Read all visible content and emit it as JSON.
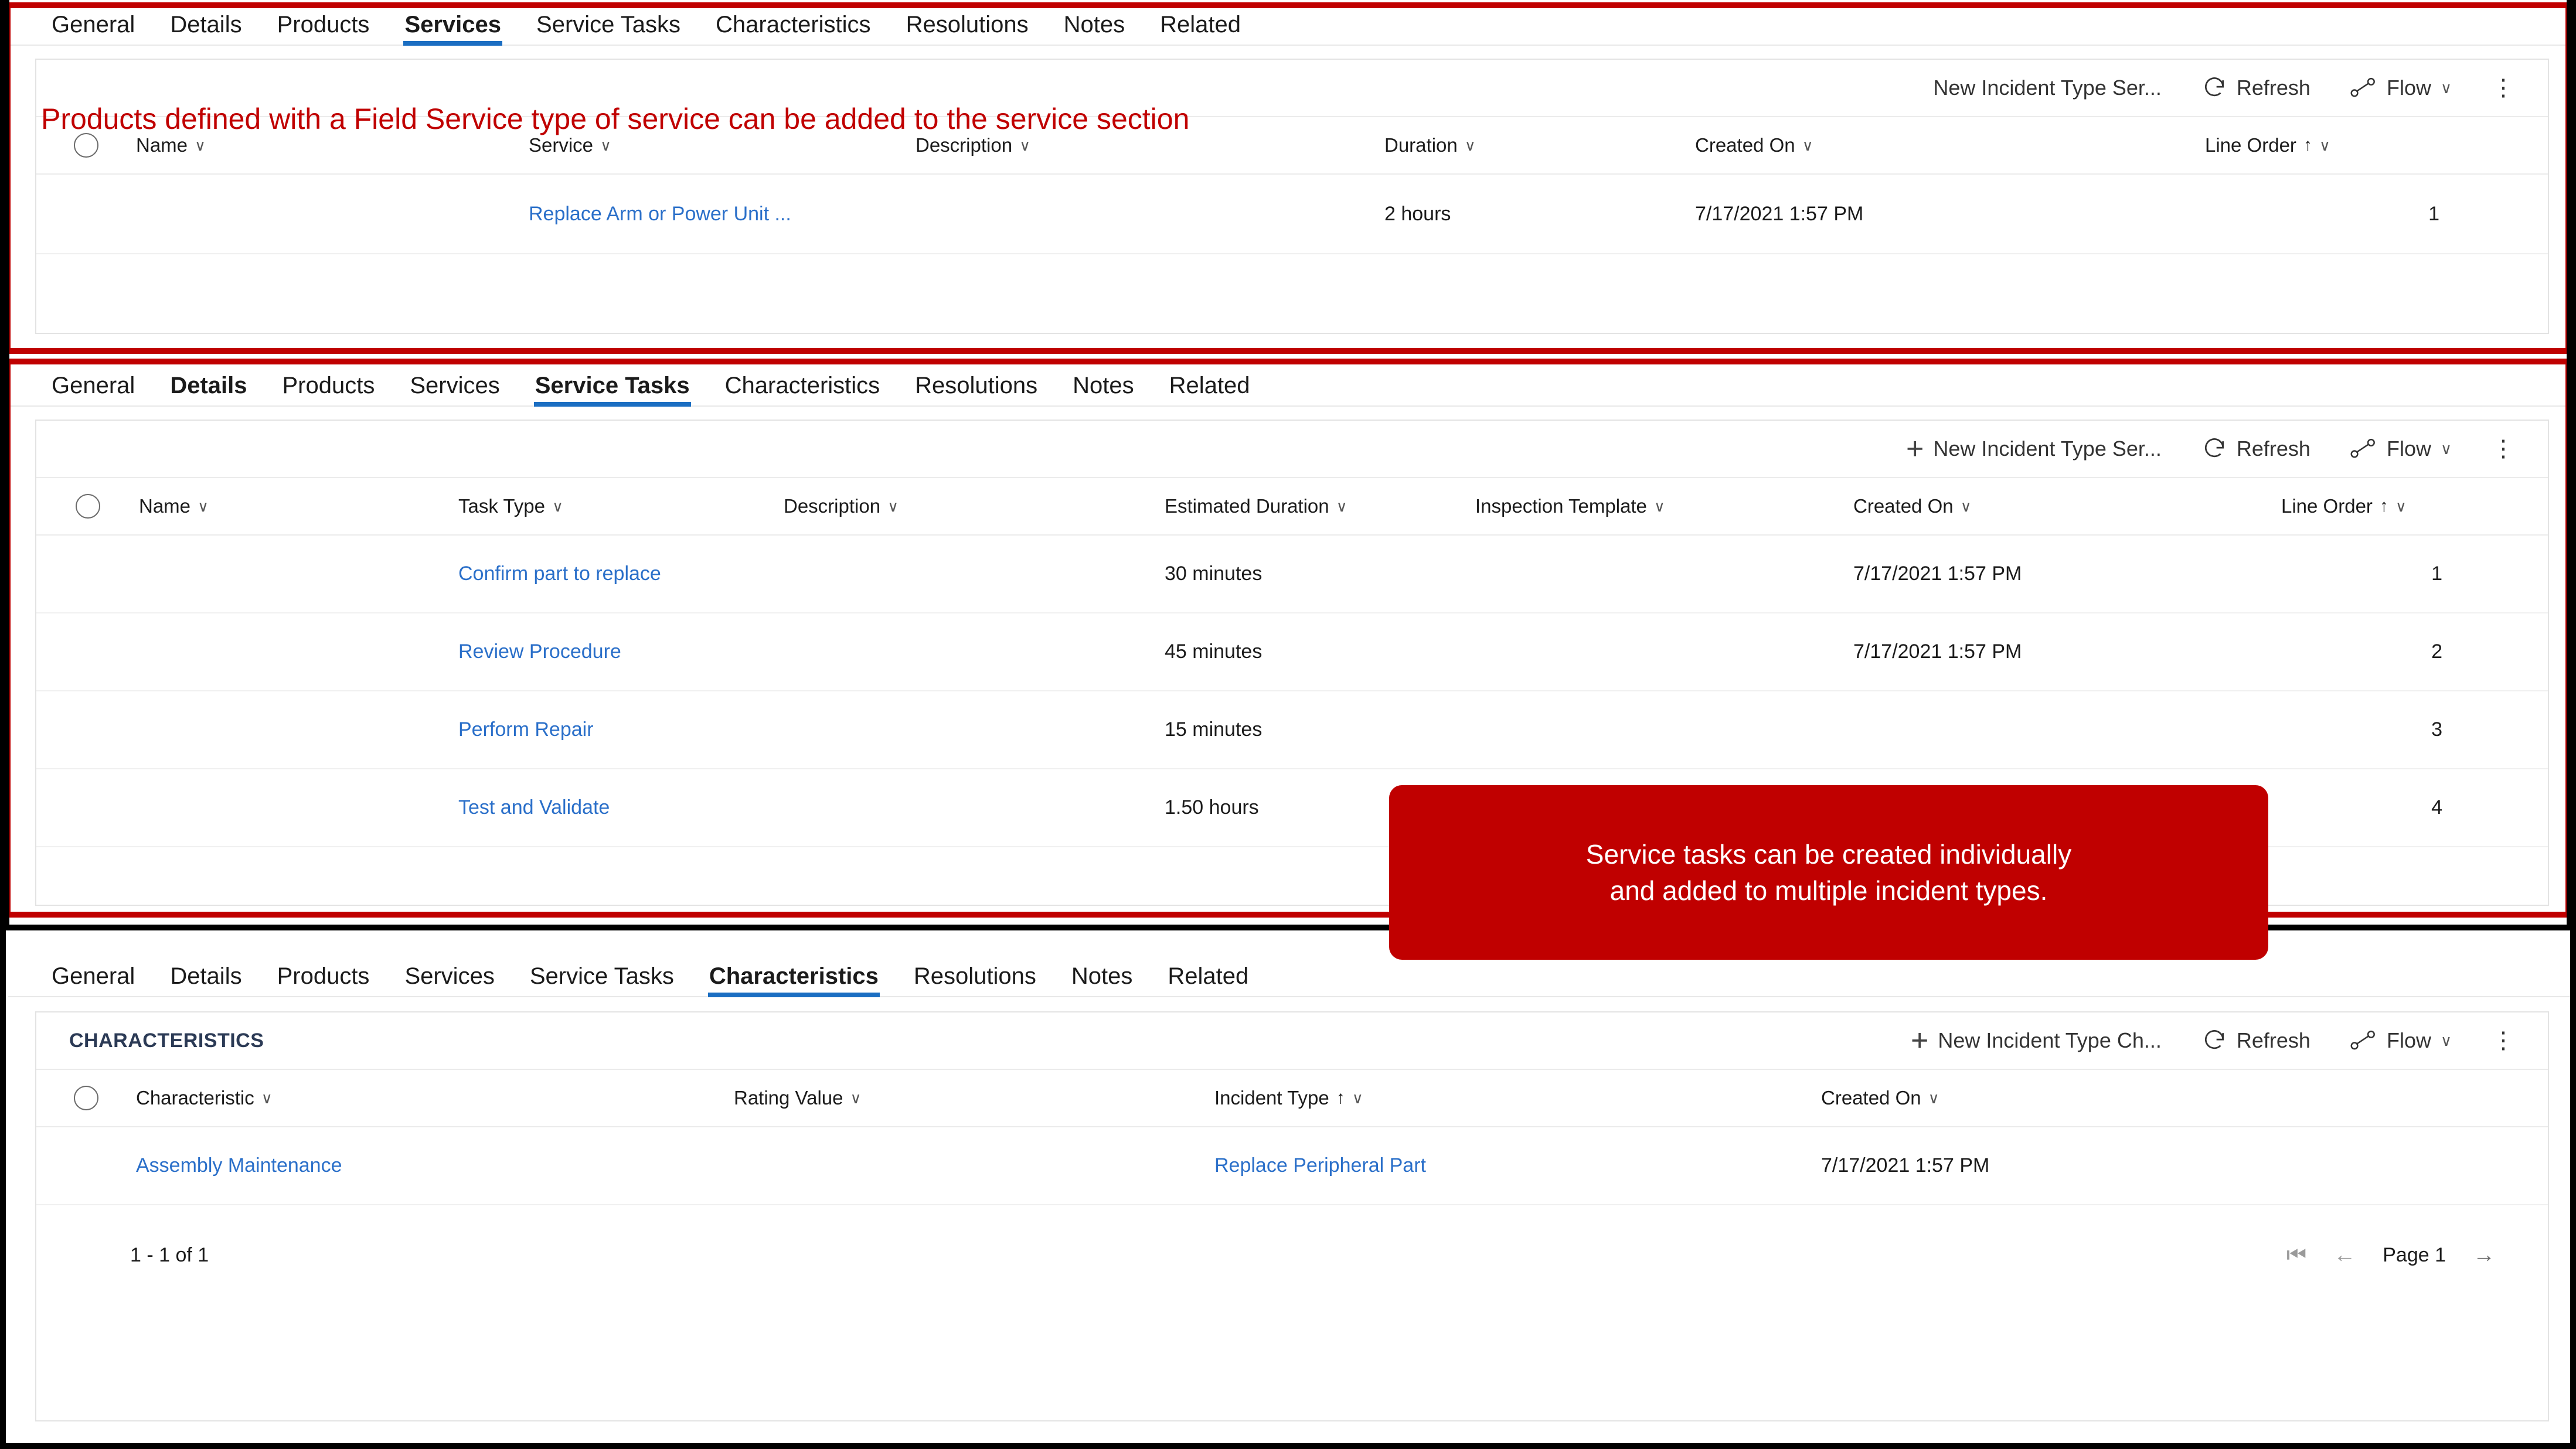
{
  "colors": {
    "accent_blue": "#1b6ec2",
    "link_blue": "#2a6fc9",
    "callout_red": "#c00000",
    "text": "#1b1b1b",
    "border": "#e3e3e3"
  },
  "tabs": [
    "General",
    "Details",
    "Products",
    "Services",
    "Service Tasks",
    "Characteristics",
    "Resolutions",
    "Notes",
    "Related"
  ],
  "commands": {
    "new_service_label": "New Incident Type Ser...",
    "new_characteristic_label": "New Incident Type Ch...",
    "refresh_label": "Refresh",
    "flow_label": "Flow",
    "plus_glyph": "+",
    "refresh_glyph": "↻",
    "flow_glyph": "↗",
    "chevron_glyph": "∨",
    "overflow_glyph": "⋮"
  },
  "panel_services": {
    "active_tab": "Services",
    "bold_tabs": [
      "Services"
    ],
    "callout": "Products defined with a Field Service type of service can be added to the service section",
    "columns": [
      {
        "label": "Name",
        "sortable": true
      },
      {
        "label": "Service",
        "sortable": true
      },
      {
        "label": "Description",
        "sortable": true
      },
      {
        "label": "Duration",
        "sortable": true
      },
      {
        "label": "Created On",
        "sortable": true
      },
      {
        "label": "Line Order",
        "sortable": true,
        "sort": "asc"
      }
    ],
    "rows": [
      {
        "name": "",
        "service": "Replace Arm or Power Unit ...",
        "description": "",
        "duration": "2 hours",
        "created_on": "7/17/2021 1:57 PM",
        "line_order": "1"
      }
    ]
  },
  "panel_service_tasks": {
    "active_tab": "Service Tasks",
    "bold_tabs": [
      "Details",
      "Service Tasks"
    ],
    "callout": "Service tasks can be created individually and added to multiple incident types.",
    "callout_line1": "Service tasks can be created individually",
    "callout_line2": "and added to multiple incident types.",
    "columns": [
      {
        "label": "Name",
        "sortable": true
      },
      {
        "label": "Task Type",
        "sortable": true
      },
      {
        "label": "Description",
        "sortable": true
      },
      {
        "label": "Estimated Duration",
        "sortable": true
      },
      {
        "label": "Inspection Template",
        "sortable": true
      },
      {
        "label": "Created On",
        "sortable": true
      },
      {
        "label": "Line Order",
        "sortable": true,
        "sort": "asc"
      }
    ],
    "rows": [
      {
        "name": "",
        "task_type": "Confirm part to replace",
        "description": "",
        "estimated_duration": "30 minutes",
        "inspection_template": "",
        "created_on": "7/17/2021 1:57 PM",
        "line_order": "1"
      },
      {
        "name": "",
        "task_type": "Review Procedure",
        "description": "",
        "estimated_duration": "45 minutes",
        "inspection_template": "",
        "created_on": "7/17/2021 1:57 PM",
        "line_order": "2"
      },
      {
        "name": "",
        "task_type": "Perform Repair",
        "description": "",
        "estimated_duration": "15 minutes",
        "inspection_template": "",
        "created_on": "",
        "line_order": "3"
      },
      {
        "name": "",
        "task_type": "Test and Validate",
        "description": "",
        "estimated_duration": "1.50 hours",
        "inspection_template": "",
        "created_on": "",
        "line_order": "4"
      }
    ]
  },
  "panel_characteristics": {
    "active_tab": "Characteristics",
    "bold_tabs": [
      "Characteristics"
    ],
    "section_title": "CHARACTERISTICS",
    "columns": [
      {
        "label": "Characteristic",
        "sortable": true
      },
      {
        "label": "Rating Value",
        "sortable": true
      },
      {
        "label": "Incident Type",
        "sortable": true,
        "sort": "asc"
      },
      {
        "label": "Created On",
        "sortable": true
      }
    ],
    "rows": [
      {
        "characteristic": "Assembly Maintenance",
        "rating_value": "",
        "incident_type": "Replace Peripheral Part",
        "created_on": "7/17/2021 1:57 PM"
      }
    ],
    "footer": {
      "record_count": "1 - 1 of 1",
      "page_label": "Page 1",
      "first_glyph": "❘◁",
      "prev_glyph": "←",
      "next_glyph": "→"
    }
  }
}
